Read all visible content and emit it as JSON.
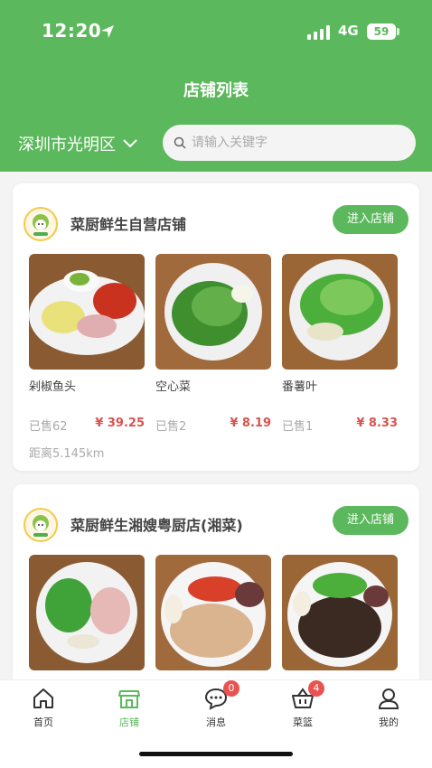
{
  "status": {
    "time": "12:20",
    "network": "4G",
    "battery": "59"
  },
  "header": {
    "title": "店铺列表",
    "city": "深圳市光明区",
    "search_placeholder": "请输入关键字"
  },
  "shops": [
    {
      "name": "菜厨鲜生自营店铺",
      "enter_label": "进入店铺",
      "distance": "距离5.145km",
      "products": [
        {
          "name": "剁椒鱼头",
          "sold": "已售62",
          "price": "¥ 39.25"
        },
        {
          "name": "空心菜",
          "sold": "已售2",
          "price": "¥ 8.19"
        },
        {
          "name": "番薯叶",
          "sold": "已售1",
          "price": "¥ 8.33"
        }
      ]
    },
    {
      "name": "菜厨鲜生湘嫂粤厨店(湘菜)",
      "enter_label": "进入店铺"
    }
  ],
  "tabbar": {
    "home": "首页",
    "store": "店铺",
    "messages": "消息",
    "messages_badge": "0",
    "basket": "菜篮",
    "basket_badge": "4",
    "mine": "我的"
  },
  "colors": {
    "brand": "#5cb85c",
    "price": "#d9534f",
    "badge": "#e9534f"
  }
}
